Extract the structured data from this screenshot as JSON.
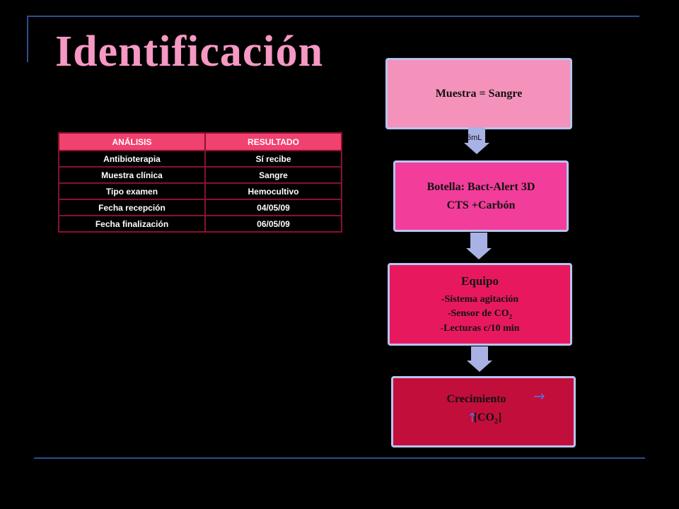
{
  "title": "Identificación",
  "table": {
    "headers": [
      "ANÁLISIS",
      "RESULTADO"
    ],
    "rows": [
      [
        "Antibioterapia",
        "Sí recibe"
      ],
      [
        "Muestra clínica",
        "Sangre"
      ],
      [
        "Tipo examen",
        "Hemocultivo"
      ],
      [
        "Fecha recepción",
        "04/05/09"
      ],
      [
        "Fecha finalización",
        "06/05/09"
      ]
    ]
  },
  "flow": {
    "step1": "Muestra = Sangre",
    "arrow1_label": "5mL",
    "step2_line1": "Botella: Bact-Alert 3D",
    "step2_line2": "CTS +Carbón",
    "step3_head": "Equipo",
    "step3_items": [
      "-Sistema agitación",
      "-Sensor de CO",
      "-Lecturas c/10 min"
    ],
    "step3_subscript": "2",
    "step4_line1": "Crecimiento",
    "step4_line2": "[CO",
    "step4_line2_sub": "2",
    "step4_line2_end": "]",
    "right_arrow": "→",
    "up_arrow": "↑"
  },
  "colors": {
    "title": "#f598c4",
    "frame": "#2e4d8f",
    "table_header": "#f0416f",
    "box1": "#f492bb",
    "box2": "#f23d9a",
    "box3": "#e8185f",
    "box4": "#c20e3b",
    "arrow": "#a8b2e4"
  }
}
